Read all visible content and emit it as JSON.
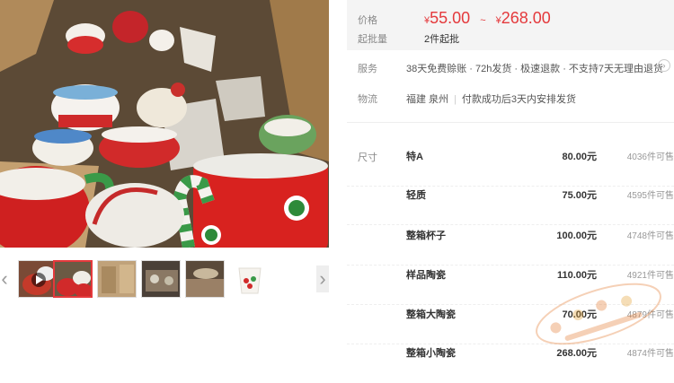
{
  "gallery": {
    "thumbnails": [
      {
        "icon": "video-play-icon",
        "active": false
      },
      {
        "active": true
      },
      {
        "active": false
      },
      {
        "active": false
      },
      {
        "active": false
      },
      {
        "active": false
      }
    ],
    "prev_arrow": "‹",
    "next_arrow": "›"
  },
  "price": {
    "label": "价格",
    "currency_symbol": "¥",
    "low": "55.00",
    "separator": "~",
    "high": "268.00",
    "moq_label": "起批量",
    "moq_value": "2件起批"
  },
  "service": {
    "label": "服务",
    "text": "38天免费赊账 · 72h发货 · 极速退款 · 不支持7天无理由退货"
  },
  "logistics": {
    "label": "物流",
    "origin": "福建 泉州",
    "note": "付款成功后3天内安排发货"
  },
  "sku": {
    "label": "尺寸",
    "items": [
      {
        "name": "特A",
        "price": "80.00元",
        "stock": "4036件可售"
      },
      {
        "name": "轻质",
        "price": "75.00元",
        "stock": "4595件可售"
      },
      {
        "name": "整箱杯子",
        "price": "100.00元",
        "stock": "4748件可售"
      },
      {
        "name": "样品陶瓷",
        "price": "110.00元",
        "stock": "4921件可售"
      },
      {
        "name": "整箱大陶瓷",
        "price": "70.00元",
        "stock": "4879件可售"
      },
      {
        "name": "整箱小陶瓷",
        "price": "268.00元",
        "stock": "4874件可售"
      }
    ]
  },
  "colors": {
    "accent": "#e4393c",
    "price_bg": "#f4f4f4"
  }
}
